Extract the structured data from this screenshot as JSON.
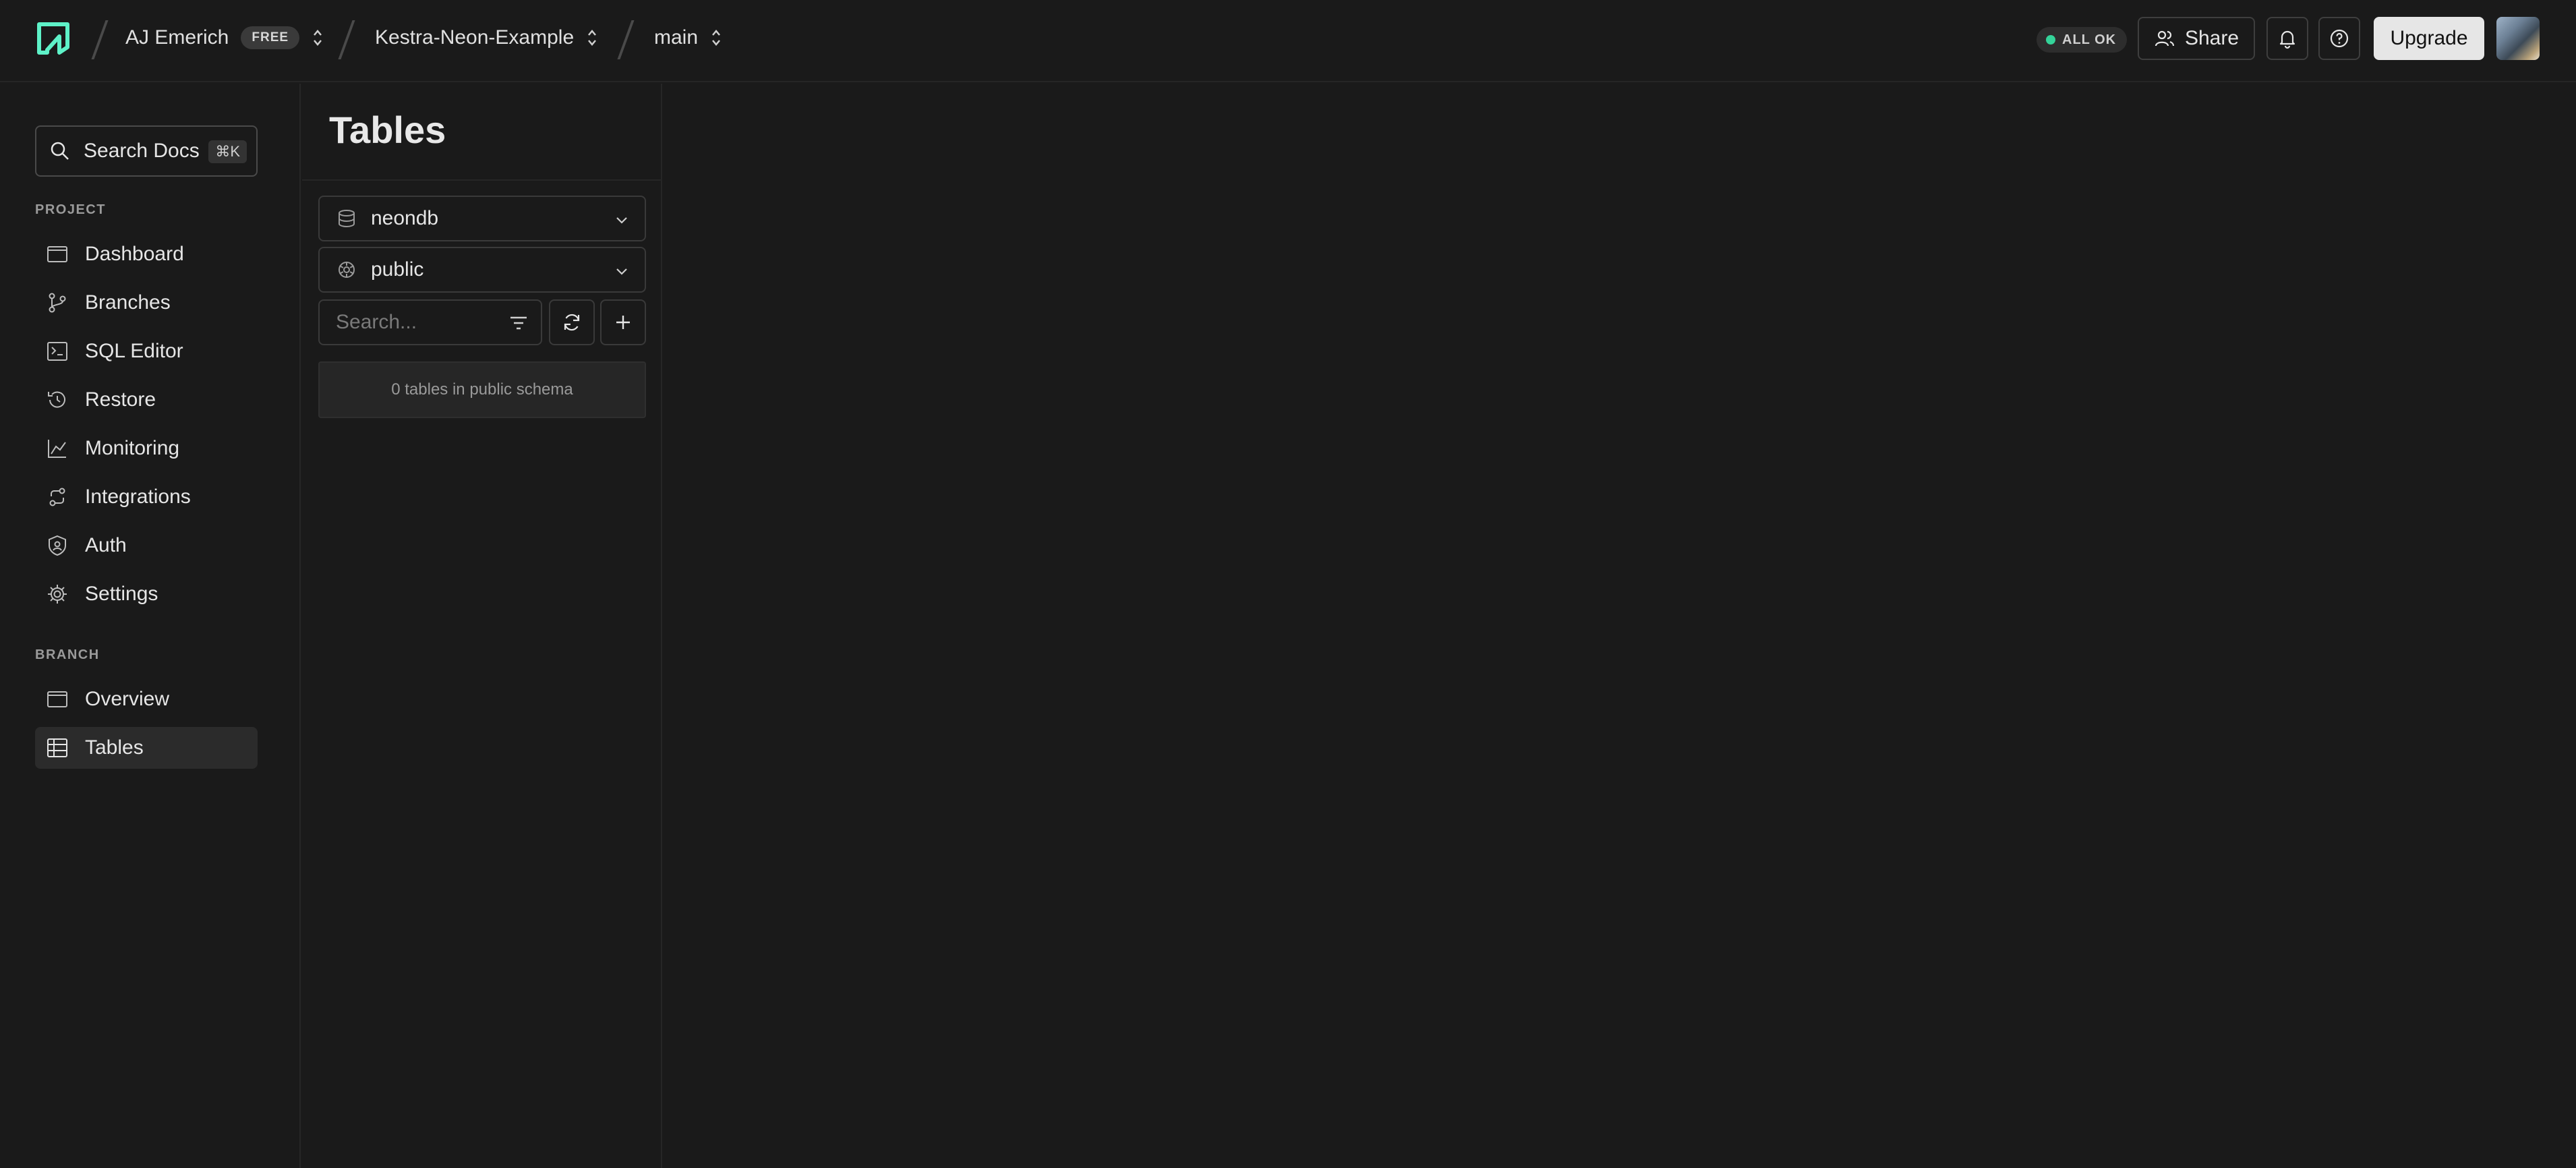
{
  "header": {
    "org_name": "AJ Emerich",
    "plan_badge": "FREE",
    "project_name": "Kestra-Neon-Example",
    "branch_name": "main",
    "status_text": "ALL OK",
    "share_label": "Share",
    "upgrade_label": "Upgrade",
    "status_color": "#34d399",
    "logo_color": "#5ef2c8"
  },
  "sidebar": {
    "search_label": "Search Docs",
    "search_shortcut": "⌘K",
    "project_section": "PROJECT",
    "project_items": [
      {
        "label": "Dashboard",
        "icon": "dashboard-icon"
      },
      {
        "label": "Branches",
        "icon": "branches-icon"
      },
      {
        "label": "SQL Editor",
        "icon": "sql-editor-icon"
      },
      {
        "label": "Restore",
        "icon": "restore-icon"
      },
      {
        "label": "Monitoring",
        "icon": "monitoring-icon"
      },
      {
        "label": "Integrations",
        "icon": "integrations-icon"
      },
      {
        "label": "Auth",
        "icon": "auth-icon"
      },
      {
        "label": "Settings",
        "icon": "gear-icon"
      }
    ],
    "branch_section": "BRANCH",
    "branch_items": [
      {
        "label": "Overview",
        "icon": "overview-icon"
      },
      {
        "label": "Tables",
        "icon": "tables-icon",
        "active": true
      }
    ]
  },
  "tables_panel": {
    "title": "Tables",
    "database": "neondb",
    "schema": "public",
    "search_placeholder": "Search...",
    "empty_message": "0 tables in public schema"
  }
}
